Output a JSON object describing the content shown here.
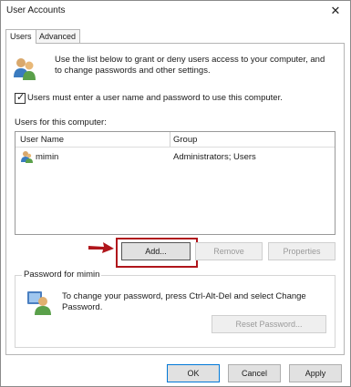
{
  "window": {
    "title": "User Accounts",
    "close_glyph": "✕"
  },
  "tabs": [
    {
      "label": "Users",
      "active": true
    },
    {
      "label": "Advanced",
      "active": false
    }
  ],
  "intro": {
    "icon": "users-icon",
    "text": "Use the list below to grant or deny users access to your computer, and to change passwords and other settings."
  },
  "must_login": {
    "checked": true,
    "check_glyph": "✓",
    "label": "Users must enter a user name and password to use this computer."
  },
  "users_section": {
    "label": "Users for this computer:",
    "columns": [
      "User Name",
      "Group"
    ],
    "rows": [
      {
        "icon": "user-icon",
        "name": "mimin",
        "group": "Administrators; Users"
      }
    ]
  },
  "buttons": {
    "add": "Add...",
    "remove": "Remove",
    "properties": "Properties"
  },
  "annotation": {
    "highlight_color": "#b0151b",
    "points_to": "Add..."
  },
  "password_group": {
    "title": "Password for mimin",
    "icon": "password-user-icon",
    "text": "To change your password, press Ctrl-Alt-Del and select Change Password.",
    "reset_button": "Reset Password..."
  },
  "footer": {
    "ok": "OK",
    "cancel": "Cancel",
    "apply": "Apply"
  },
  "colors": {
    "accent": "#0078d7",
    "highlight": "#b0151b"
  }
}
